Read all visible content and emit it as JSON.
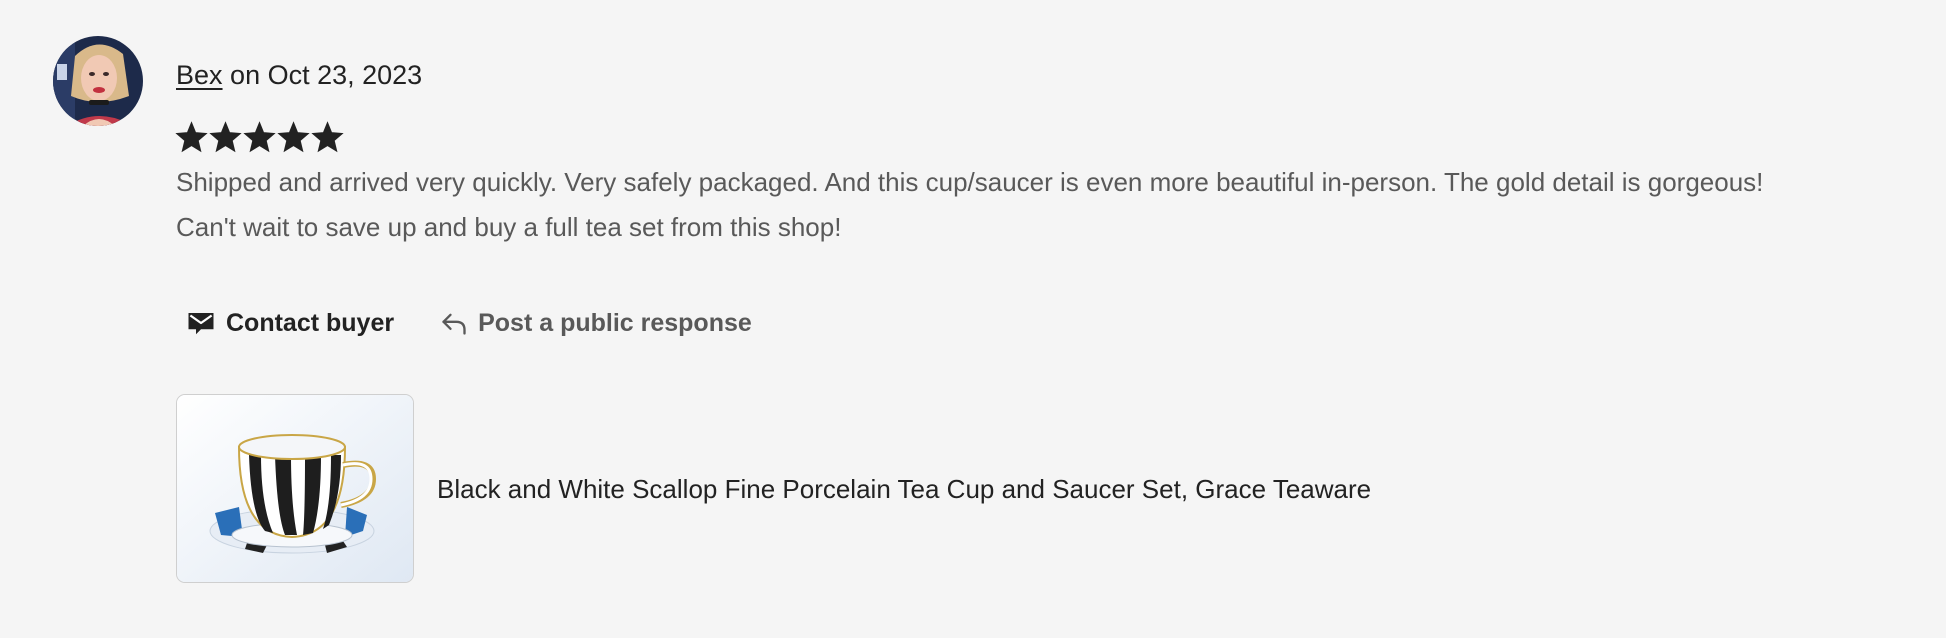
{
  "review": {
    "author": "Bex",
    "date_text": "on Oct 23, 2023",
    "rating": 5,
    "rating_max": 5,
    "text_lines": [
      "Shipped and arrived very quickly. Very safely packaged. And this cup/saucer is even more beautiful in-person. The gold detail is gorgeous!",
      "Can't wait to save up and buy a full tea set from this shop!"
    ]
  },
  "actions": {
    "contact_label": "Contact buyer",
    "respond_label": "Post a public response"
  },
  "listing": {
    "title": "Black and White Scallop Fine Porcelain Tea Cup and Saucer Set, Grace Teaware"
  },
  "icons": {
    "contact": "envelope-icon",
    "respond": "reply-arrow-icon",
    "star": "star-icon"
  },
  "colors": {
    "background": "#f5f5f5",
    "text_primary": "#222222",
    "text_secondary": "#595959"
  }
}
